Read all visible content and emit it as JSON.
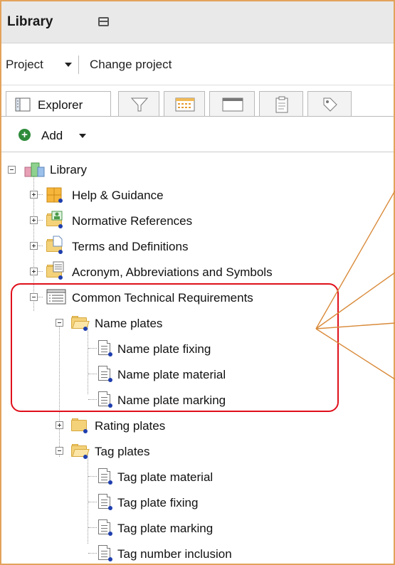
{
  "header": {
    "title": "Library"
  },
  "project_bar": {
    "project_label": "Project",
    "change_label": "Change project"
  },
  "tabs": [
    {
      "label": "Explorer",
      "icon": "explorer-icon",
      "active": true
    },
    {
      "label": "",
      "icon": "filter-icon"
    },
    {
      "label": "",
      "icon": "grid-icon"
    },
    {
      "label": "",
      "icon": "window-icon"
    },
    {
      "label": "",
      "icon": "clipboard-icon"
    },
    {
      "label": "",
      "icon": "tag-icon"
    }
  ],
  "toolbar": {
    "add_label": "Add"
  },
  "tree": {
    "root": "Library",
    "items": [
      {
        "label": "Help & Guidance"
      },
      {
        "label": "Normative References"
      },
      {
        "label": "Terms and Definitions"
      },
      {
        "label": "Acronym, Abbreviations and Symbols"
      },
      {
        "label": "Common Technical Requirements"
      },
      {
        "label": "Name plates"
      },
      {
        "label": "Name plate fixing"
      },
      {
        "label": "Name plate material"
      },
      {
        "label": "Name plate marking"
      },
      {
        "label": "Rating plates"
      },
      {
        "label": "Tag plates"
      },
      {
        "label": "Tag plate material"
      },
      {
        "label": "Tag plate fixing"
      },
      {
        "label": "Tag plate marking"
      },
      {
        "label": "Tag number inclusion"
      }
    ]
  },
  "colors": {
    "accent_border": "#e3a35c",
    "highlight": "#e0101c",
    "callout": "#d98a3a",
    "folder": "#f4d27a"
  }
}
